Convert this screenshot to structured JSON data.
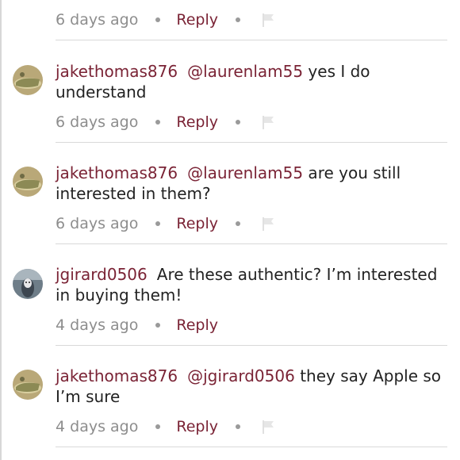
{
  "top_meta": {
    "time": "6 days ago",
    "reply_label": "Reply"
  },
  "comments": [
    {
      "username": "jakethomas876",
      "mention": "@laurenlam55",
      "text_line1": " yes I do",
      "text_line2": "understand",
      "time": "6 days ago",
      "reply_label": "Reply"
    },
    {
      "username": "jakethomas876",
      "mention": "@laurenlam55",
      "text_line1": " are you still",
      "text_line2": "interested in them?",
      "time": "6 days ago",
      "reply_label": "Reply"
    },
    {
      "username": "jgirard0506",
      "mention": "",
      "text_line1": "Are these authentic? I’m interested",
      "text_line2": "in buying them!",
      "time": "4 days ago",
      "reply_label": "Reply"
    },
    {
      "username": "jakethomas876",
      "mention": "@jgirard0506",
      "text_line1": " they say Apple so",
      "text_line2": "I’m sure",
      "time": "4 days ago",
      "reply_label": "Reply"
    }
  ],
  "colors": {
    "accent": "#7a2335",
    "text": "#222222",
    "muted": "#8d8d8d",
    "divider": "#d9d9d9"
  },
  "icons": {
    "flag": "flag-icon"
  }
}
